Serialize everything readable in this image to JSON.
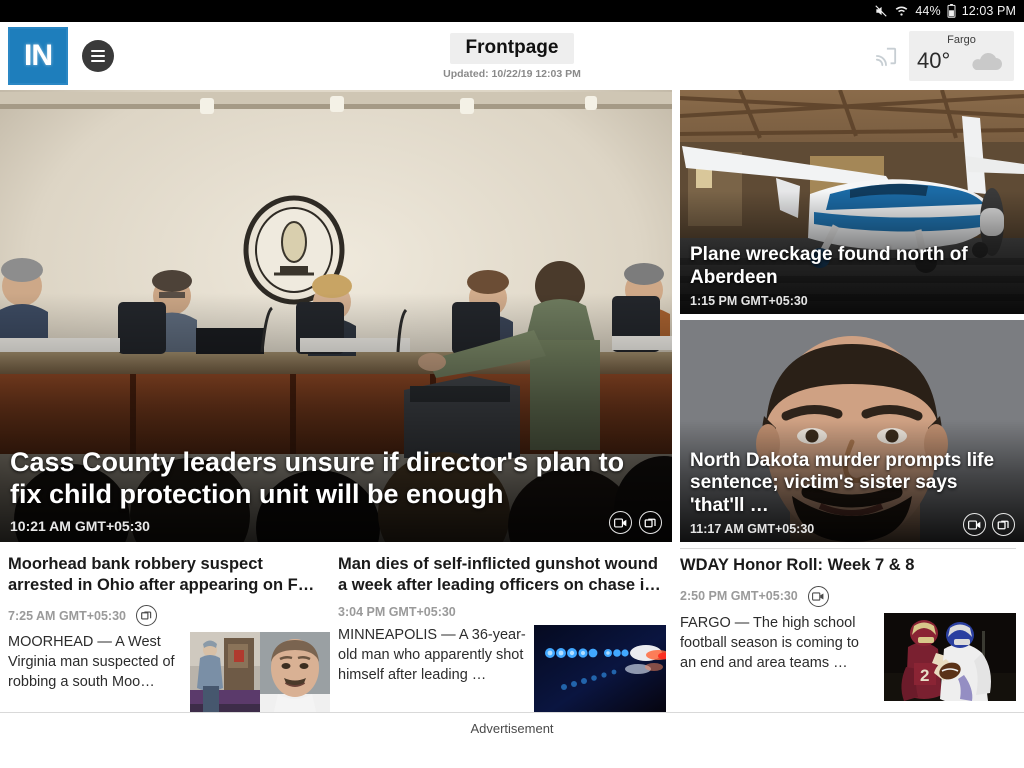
{
  "statusbar": {
    "mute_icon": "mute-icon",
    "wifi_icon": "wifi-icon",
    "battery_percent": "44%",
    "battery_icon": "battery-icon",
    "clock": "12:03 PM"
  },
  "header": {
    "logo_text": "IN",
    "logo_color": "#1e7ebc",
    "menu_icon": "hamburger-menu-icon",
    "title": "Frontpage",
    "updated": "Updated: 10/22/19 12:03 PM",
    "cast_icon": "cast-icon",
    "weather": {
      "city": "Fargo",
      "temp": "40°",
      "condition_icon": "cloud-icon"
    }
  },
  "hero": {
    "headline": "Cass County leaders unsure if director's plan to fix child protection unit will be enough",
    "time": "10:21 AM GMT+05:30",
    "badges": [
      "video-icon",
      "gallery-icon"
    ],
    "image_alt": "county-board-meeting-photo"
  },
  "side_cards": [
    {
      "headline": "Plane wreckage found north of Aberdeen",
      "time": "1:15 PM GMT+05:30",
      "badges": [],
      "image_alt": "small-plane-in-hangar-photo"
    },
    {
      "headline": "North Dakota murder prompts life sentence; victim's sister says 'that'll …",
      "time": "11:17 AM GMT+05:30",
      "badges": [
        "video-icon",
        "gallery-icon"
      ],
      "image_alt": "mugshot-photo"
    }
  ],
  "bottom_cards": [
    {
      "headline": "Moorhead bank robbery suspect arrested in Ohio after appearing on F…",
      "time": "7:25 AM GMT+05:30",
      "badges": [
        "gallery-icon"
      ],
      "summary": "MOORHEAD — A West Virginia man suspected of robbing a south Moo…",
      "thumbs": [
        "surveillance-photo",
        "mugshot-photo"
      ]
    },
    {
      "headline": "Man dies of self-inflicted gunshot wound a week after leading officers on chase i…",
      "time": "3:04 PM GMT+05:30",
      "badges": [],
      "summary": "MINNEAPOLIS — A 36-year-old man who apparently shot himself after leading …",
      "thumbs": [
        "police-lights-photo"
      ]
    },
    {
      "headline": "WDAY Honor Roll: Week 7 & 8",
      "time": "2:50 PM GMT+05:30",
      "badges": [
        "video-icon"
      ],
      "summary": "FARGO — The high school football season is coming to an end and area teams …",
      "thumbs": [
        "football-players-photo"
      ]
    }
  ],
  "footer": {
    "ad_label": "Advertisement"
  }
}
